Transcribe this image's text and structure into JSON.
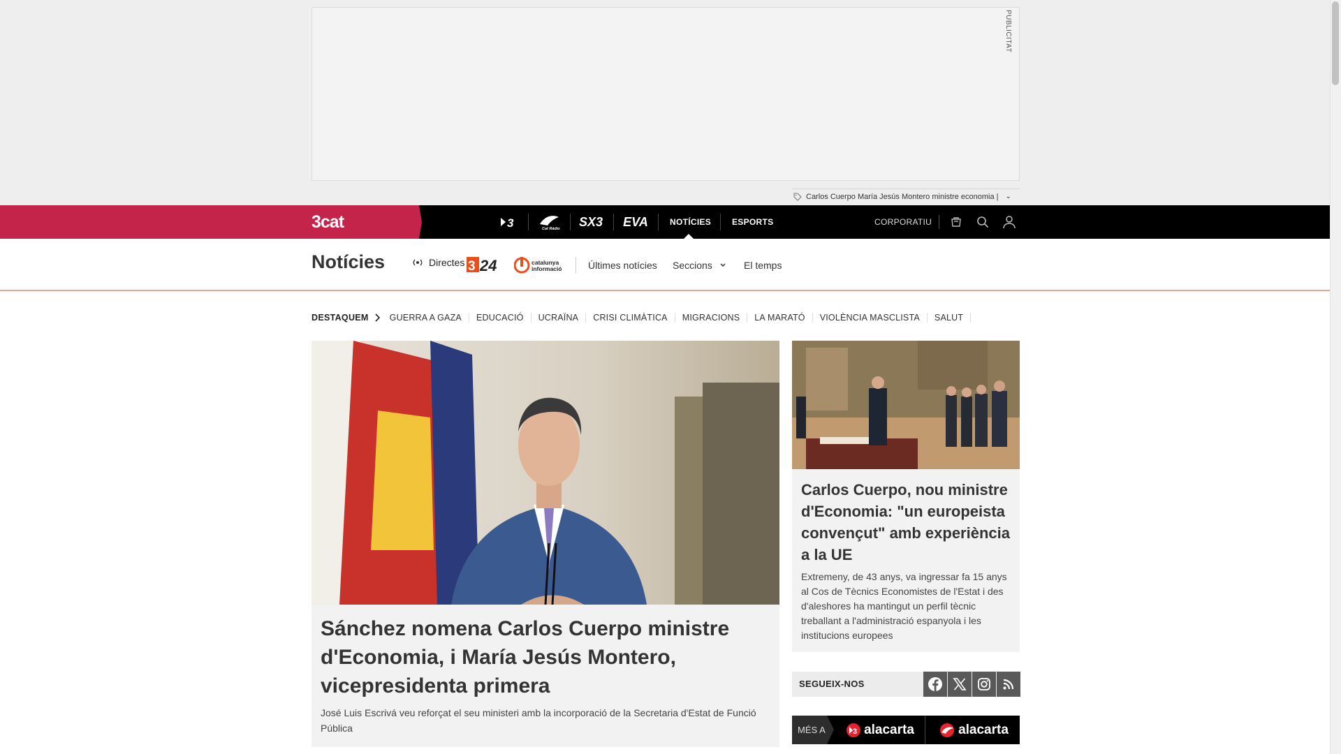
{
  "ad": {
    "label": "PUBLICITAT"
  },
  "breaking": {
    "text": "Carlos Cuerpo María Jesús Montero ministre economia |"
  },
  "topbar": {
    "logo": "3cat",
    "channels": [
      "3",
      "Cat Ràdio",
      "SX3",
      "EVA"
    ],
    "nav_noticies": "NOTÍCIES",
    "nav_esports": "ESPORTS",
    "corporatiu": "CORPORATIU"
  },
  "section": {
    "title": "Notícies",
    "directes": "Directes",
    "channel_324": "324",
    "catalunya_informacio": "catalunya informació",
    "subnav": [
      "Últimes notícies",
      "Seccions",
      "El temps"
    ]
  },
  "topics": {
    "lead": "DESTAQUEM",
    "items": [
      "GUERRA A GAZA",
      "EDUCACIÓ",
      "UCRAÏNA",
      "CRISI CLIMÀTICA",
      "MIGRACIONS",
      "LA MARATÓ",
      "VIOLÈNCIA MASCLISTA",
      "SALUT"
    ]
  },
  "main_article": {
    "headline": "Sánchez nomena Carlos Cuerpo ministre d'Economia, i María Jesús Montero, vicepresidenta primera",
    "summary": "José Luis Escrivá veu reforçat el seu ministeri amb la incorporació de la Secretaria d'Estat de Funció Pública"
  },
  "side_article": {
    "headline": "Carlos Cuerpo, nou ministre d'Economia: \"un europeista convençut\" amb experiència a la UE",
    "summary": "Extremeny, de 43 anys, va ingressar fa 15 anys al Cos de Tècnics Economistes de l'Estat i des d'aleshores ha mantingut un perfil tècnic treballant a l'administració espanyola i les institucions europees"
  },
  "follow": {
    "label": "SEGUEIX-NOS",
    "networks": [
      "facebook-icon",
      "x-icon",
      "instagram-icon",
      "rss-icon"
    ]
  },
  "mes_a": {
    "label": "MÉS A",
    "items": [
      "alacarta",
      "alacarta"
    ]
  },
  "colors": {
    "brand": "#c4234a",
    "topbar": "#000000",
    "subnav_border": "#e9a489",
    "social_bg": "#595959"
  }
}
